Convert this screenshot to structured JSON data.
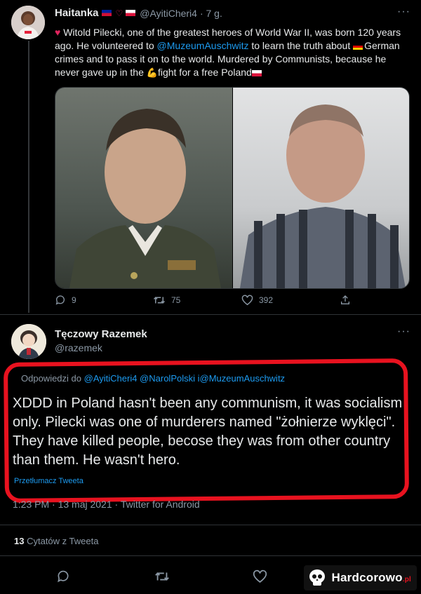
{
  "tweet1": {
    "author_name": "Haitanka",
    "author_handle": "@AyitiCheri4",
    "time": "· 7 g.",
    "more": "···",
    "text_1": "Witold Pilecki, one of the greatest heroes of World War II, was born 120 years ago. He volunteered to ",
    "mention": "@MuzeumAuschwitz",
    "text_2": " to learn the truth about ",
    "text_3": "German crimes and to pass it on to the world. Murdered by Communists, because he never gave up in the ",
    "text_4": "fight for a free Poland",
    "replies": "9",
    "retweets": "75",
    "likes": "392"
  },
  "tweet2": {
    "author_name": "Tęczowy Razemek",
    "author_handle": "@razemek",
    "more": "···",
    "reply_to_prefix": "Odpowiedzi do ",
    "reply_to_mentions": "@AyitiCheri4 @NarolPolski i@MuzeumAuschwitz",
    "text": "XDDD in Poland hasn't been any communism, it was socialism only. Pilecki was one of murderers named \"żołnierze wyklęci\". They have killed people, becose they was from other country than them. He wasn't hero.",
    "translate": "Przetłumacz Tweeta",
    "timestamp": "1:23 PM · 13 maj 2021 · Twitter for Android",
    "quote_count": "13",
    "quote_label": "Cytatów z Tweeta"
  },
  "watermark": {
    "text": "Hardcorowo",
    "tld": ".pl"
  },
  "colors": {
    "accent": "#1d9bf0",
    "highlight_box": "#e8121f",
    "background": "#000000"
  }
}
